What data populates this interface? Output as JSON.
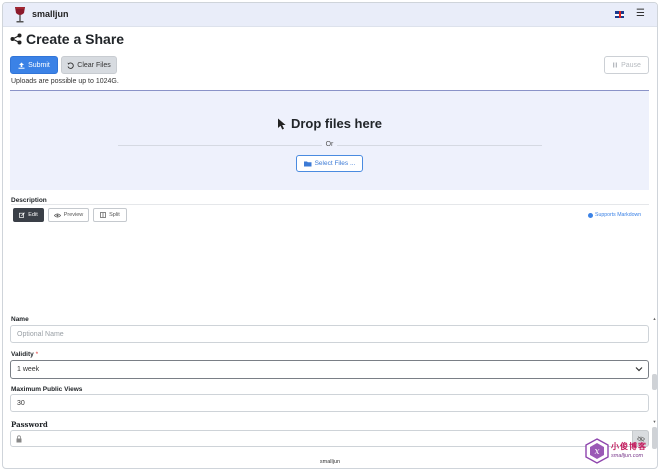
{
  "navbar": {
    "brand_name": "smalljun",
    "language_flag": "uk-flag-icon",
    "menu_icon": "hamburger-menu-icon"
  },
  "page": {
    "title": "Create a Share"
  },
  "toolbar": {
    "submit_label": "Submit",
    "clear_label": "Clear Files",
    "pause_label": "Pause"
  },
  "upload_note": "Uploads are possible up to 1024G.",
  "dropzone": {
    "title": "Drop files here",
    "or_text": "Or",
    "select_label": "Select Files ..."
  },
  "description": {
    "label": "Description",
    "tabs": [
      {
        "label": "Edit",
        "active": true
      },
      {
        "label": "Preview",
        "active": false
      },
      {
        "label": "Split",
        "active": false
      }
    ],
    "markdown_note": "Supports Markdown"
  },
  "form": {
    "name_label": "Name",
    "name_placeholder": "Optional Name",
    "validity_label": "Validity",
    "validity_required": "*",
    "validity_value": "1 week",
    "views_label": "Maximum Public Views",
    "views_value": "30",
    "password_label": "Password"
  },
  "footer": {
    "text": "smalljun"
  },
  "watermark": {
    "cn_text": "小俊博客",
    "en_text": "smalljun.com"
  },
  "colors": {
    "primary": "#3b82e6",
    "navbar_bg": "#e9edf9",
    "dropzone_bg": "#eef1fc",
    "dark_tab": "#3a3f47"
  }
}
